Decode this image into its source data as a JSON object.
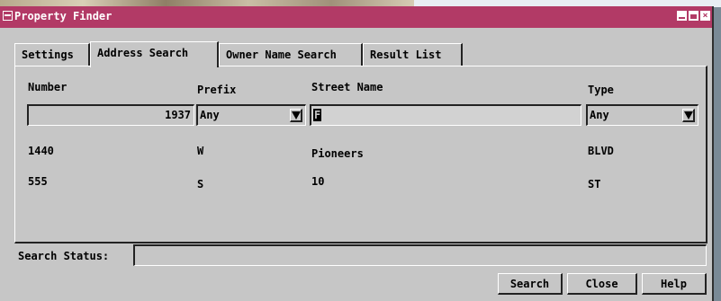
{
  "window": {
    "title": "Property Finder"
  },
  "tabs": [
    {
      "label": "Settings",
      "active": false
    },
    {
      "label": "Address Search",
      "active": true
    },
    {
      "label": "Owner Name Search",
      "active": false
    },
    {
      "label": "Result List",
      "active": false
    }
  ],
  "columns": {
    "number": "Number",
    "prefix": "Prefix",
    "street_name": "Street Name",
    "type": "Type"
  },
  "search": {
    "number_value": "1937",
    "prefix_value": "Any",
    "street_name_value": "F",
    "type_value": "Any"
  },
  "results": [
    {
      "number": "1440",
      "prefix": "W",
      "street_name": "Pioneers",
      "type": "BLVD"
    },
    {
      "number": "555",
      "prefix": "S",
      "street_name": "10",
      "type": "ST"
    }
  ],
  "status": {
    "label": "Search Status:",
    "value": ""
  },
  "buttons": {
    "search": "Search",
    "close": "Close",
    "help": "Help"
  },
  "colors": {
    "titlebar": "#b23a66",
    "window_bg": "#c6c6c6"
  }
}
